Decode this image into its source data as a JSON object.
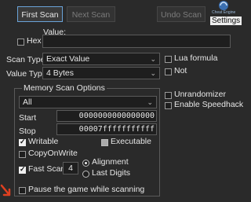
{
  "toolbar": {
    "first_scan": "First Scan",
    "next_scan": "Next Scan",
    "undo_scan": "Undo Scan",
    "logo_text": "Cheat Engine",
    "settings": "Settings"
  },
  "value": {
    "label": "Value:",
    "hex_label": "Hex",
    "hex_checked": false,
    "input": ""
  },
  "scan_type": {
    "label": "Scan Type",
    "selected": "Exact Value"
  },
  "value_type": {
    "label": "Value Type",
    "selected": "4 Bytes"
  },
  "right_options": {
    "lua_formula": "Lua formula",
    "not": "Not",
    "unrandomizer": "Unrandomizer",
    "enable_speedhack": "Enable Speedhack"
  },
  "memory": {
    "title": "Memory Scan Options",
    "region": "All",
    "start_label": "Start",
    "start_value": "0000000000000000",
    "stop_label": "Stop",
    "stop_value": "00007fffffffffff",
    "writable": "Writable",
    "executable": "Executable",
    "copy_on_write": "CopyOnWrite",
    "fast_scan": "Fast Scan",
    "fast_scan_value": "4",
    "alignment": "Alignment",
    "last_digits": "Last Digits",
    "pause": "Pause the game while scanning"
  },
  "colors": {
    "background": "#2a2a2a",
    "field": "#1e1e1e",
    "border": "#5a5a5a",
    "accent": "#e04020"
  }
}
